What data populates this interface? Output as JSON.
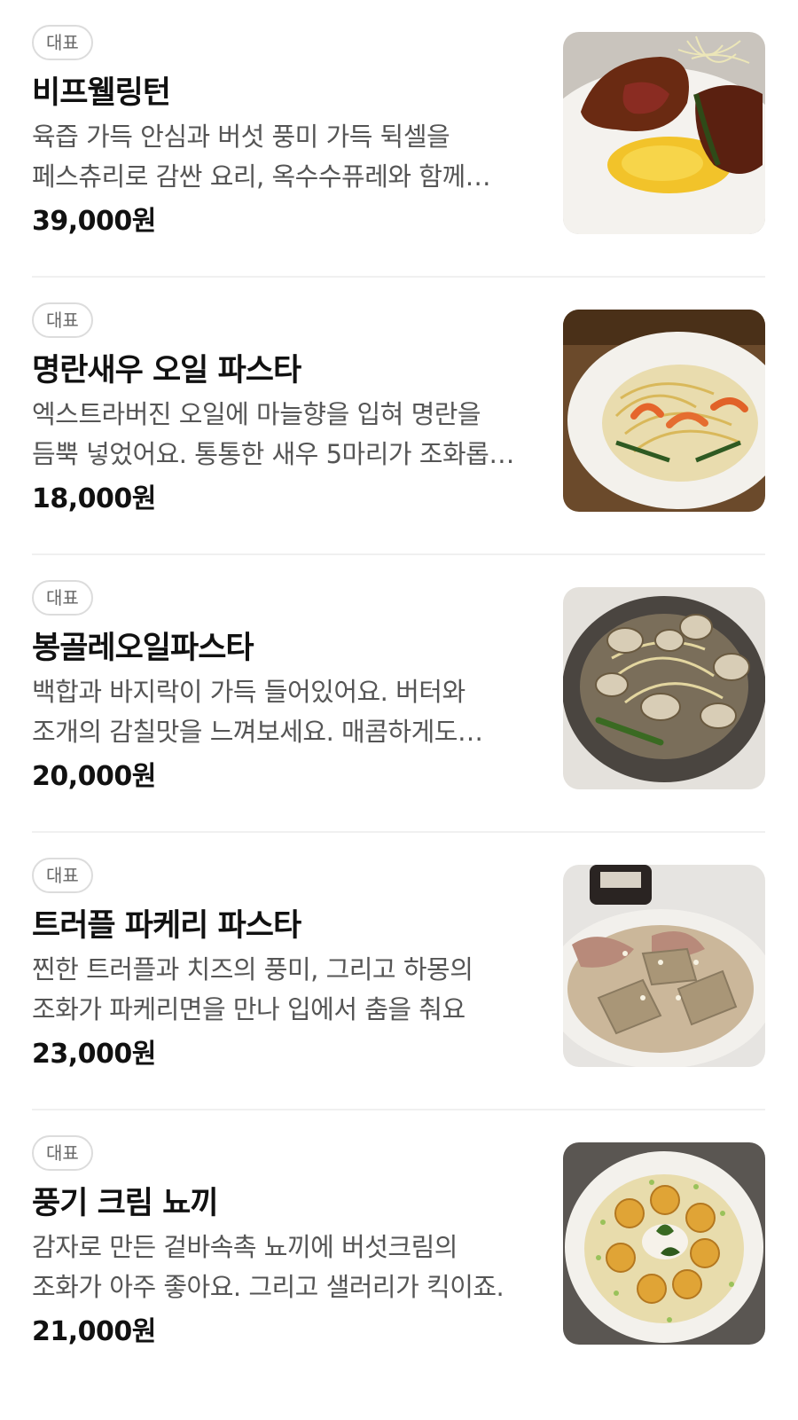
{
  "menu": {
    "items": [
      {
        "badge": "대표",
        "name": "비프웰링턴",
        "description": "육즙 가득 안심과 버섯 풍미 가득 뒥셀을 페스츄리로 감싼 요리, 옥수수퓨레와 함께 즐겨보세요.",
        "price": "39,000원",
        "image_icon": "beef-wellington-photo"
      },
      {
        "badge": "대표",
        "name": "명란새우 오일 파스타",
        "description": "엑스트라버진 오일에 마늘향을 입혀 명란을 듬뿍 넣었어요. 통통한 새우 5마리가 조화롭게 어우러져요.",
        "price": "18,000원",
        "image_icon": "shrimp-pasta-photo"
      },
      {
        "badge": "대표",
        "name": "봉골레오일파스타",
        "description": "백합과 바지락이 가득 들어있어요. 버터와 조개의 감칠맛을 느껴보세요. 매콤하게도 즐기실 수 있어요.",
        "price": "20,000원",
        "image_icon": "vongole-pasta-photo"
      },
      {
        "badge": "대표",
        "name": "트러플 파케리 파스타",
        "description": "찐한 트러플과 치즈의 풍미, 그리고 하몽의 조화가 파케리면을 만나 입에서 춤을 춰요",
        "price": "23,000원",
        "image_icon": "truffle-paccheri-photo"
      },
      {
        "badge": "대표",
        "name": "풍기 크림 뇨끼",
        "description": "감자로 만든 겉바속촉 뇨끼에 버섯크림의 조화가 아주 좋아요. 그리고 샐러리가 킥이죠.",
        "price": "21,000원",
        "image_icon": "gnocchi-cream-photo"
      }
    ]
  }
}
